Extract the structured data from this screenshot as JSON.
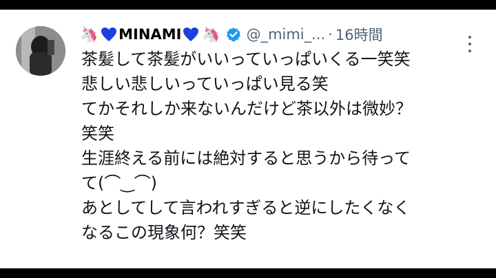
{
  "tweet": {
    "display_name": "MINAMI",
    "name_emojis": [
      "🦄",
      "🦄"
    ],
    "heart_color": "#1d3ee0",
    "verified_color": "#1d9bf0",
    "handle": "@_mimi_...",
    "separator": "·",
    "time": "16時間",
    "lines": [
      "茶髪して茶髪がいいっていっぱいくる一笑笑",
      "悲しい悲しいっていっぱい見る笑",
      "てかそれしか来ないんだけど茶以外は微妙？",
      "笑笑",
      "生涯終える前には絶対すると思うから待って",
      "て(⌒‿⌒)",
      "あとしてして言われすぎると逆にしたくなく",
      "なるこの現象何？笑笑"
    ]
  },
  "icons": {
    "more": "more-options-icon",
    "verified": "verified-badge-icon",
    "heart": "blue-heart-icon",
    "unicorn": "unicorn-emoji-icon"
  }
}
